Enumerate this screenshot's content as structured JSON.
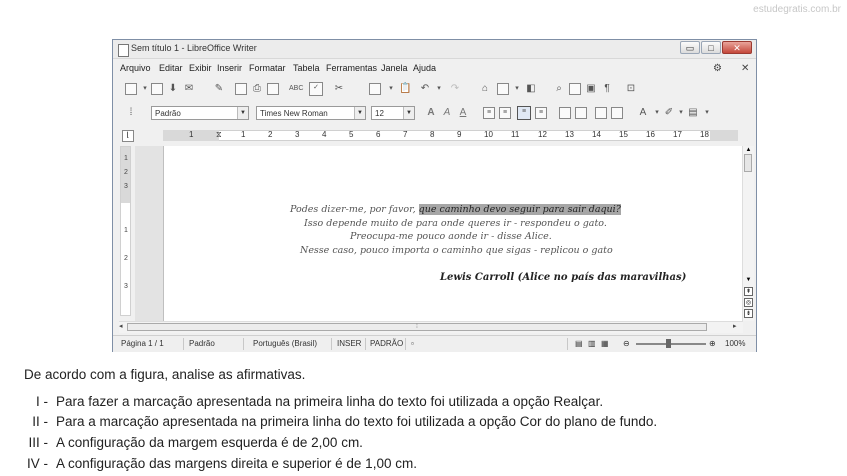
{
  "watermark": "estudegratis.com.br",
  "window": {
    "title": "Sem título 1 - LibreOffice Writer",
    "controls": {
      "minimize": "▭",
      "restore": "□",
      "close": "✕"
    }
  },
  "menu": [
    "Arquivo",
    "Editar",
    "Exibir",
    "Inserir",
    "Formatar",
    "Tabela",
    "Ferramentas",
    "Janela",
    "Ajuda"
  ],
  "formatting": {
    "style": "Padrão",
    "font": "Times New Roman",
    "size": "12"
  },
  "ruler_numbers": [
    "1",
    "2",
    "1",
    "2",
    "3",
    "4",
    "5",
    "6",
    "7",
    "8",
    "9",
    "10",
    "11",
    "12",
    "13",
    "14",
    "15",
    "16",
    "17",
    "18"
  ],
  "vruler_numbers": [
    "1",
    "2",
    "3",
    "1",
    "2",
    "3"
  ],
  "document": {
    "line1_plain": "Podes dizer-me, por favor, ",
    "line1_highlight": "que caminho devo seguir para sair daqui?",
    "line2": "Isso depende muito de para onde queres ir - respondeu o gato.",
    "line3": "Preocupa-me pouco aonde ir - disse Alice.",
    "line4": "Nesse caso, pouco importa o caminho que sigas - replicou o gato",
    "author": "Lewis Carroll  (Alice no país das maravilhas)"
  },
  "statusbar": {
    "page": "Página 1 / 1",
    "style": "Padrão",
    "language": "Português (Brasil)",
    "insert": "INSER",
    "selection": "PADRÃO",
    "zoom": "100%"
  },
  "question": {
    "prompt": "De acordo com a figura, analise as afirmativas.",
    "items": [
      {
        "num": "I -",
        "text": "Para fazer a marcação apresentada na primeira linha do texto foi utilizada a opção Realçar."
      },
      {
        "num": "II -",
        "text": "Para a marcação apresentada na primeira linha do texto foi utilizada a opção Cor do plano de fundo."
      },
      {
        "num": "III -",
        "text": "A configuração da margem esquerda é de 2,00 cm."
      },
      {
        "num": "IV -",
        "text": "A configuração das margens direita e superior é de 1,00 cm."
      }
    ]
  }
}
